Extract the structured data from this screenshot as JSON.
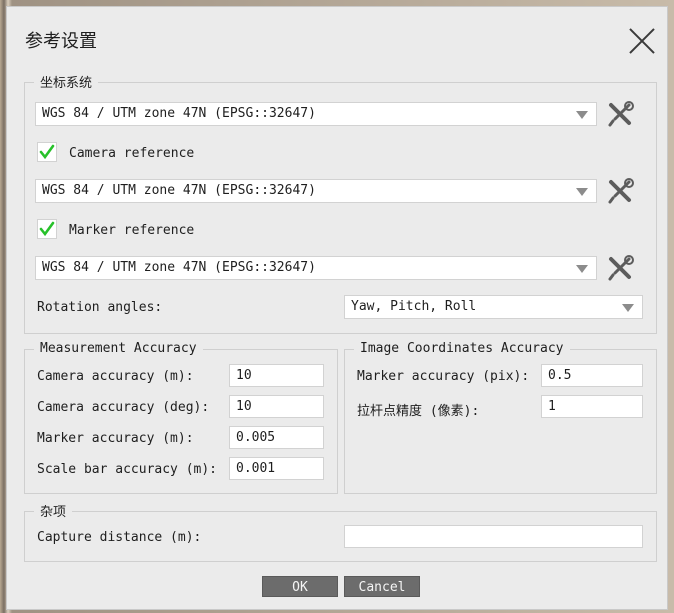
{
  "dialog": {
    "title": "参考设置"
  },
  "coordinate_system": {
    "legend": "坐标系统",
    "crs_primary": "WGS 84 / UTM zone 47N (EPSG::32647)",
    "camera_reference_label": "Camera reference",
    "camera_reference_checked": true,
    "camera_crs": "WGS 84 / UTM zone 47N (EPSG::32647)",
    "marker_reference_label": "Marker reference",
    "marker_reference_checked": true,
    "marker_crs": "WGS 84 / UTM zone 47N (EPSG::32647)",
    "rotation_angles_label": "Rotation angles:",
    "rotation_angles_value": "Yaw, Pitch, Roll"
  },
  "measurement_accuracy": {
    "legend": "Measurement Accuracy",
    "camera_accuracy_m_label": "Camera accuracy (m):",
    "camera_accuracy_m_value": "10",
    "camera_accuracy_deg_label": "Camera accuracy (deg):",
    "camera_accuracy_deg_value": "10",
    "marker_accuracy_m_label": "Marker accuracy (m):",
    "marker_accuracy_m_value": "0.005",
    "scale_bar_accuracy_label": "Scale bar accuracy (m):",
    "scale_bar_accuracy_value": "0.001"
  },
  "image_accuracy": {
    "legend": "Image Coordinates Accuracy",
    "marker_accuracy_pix_label": "Marker accuracy (pix):",
    "marker_accuracy_pix_value": "0.5",
    "tie_point_accuracy_label": "拉杆点精度 (像素):",
    "tie_point_accuracy_value": "1"
  },
  "misc": {
    "legend": "杂项",
    "capture_distance_label": "Capture distance (m):",
    "capture_distance_value": ""
  },
  "buttons": {
    "ok": "OK",
    "cancel": "Cancel"
  },
  "icons": {
    "close": "close-icon",
    "tools": "tools-icon",
    "check": "check-icon",
    "dropdown": "chevron-down-icon"
  },
  "colors": {
    "check": "#27c12a",
    "button_bg": "#6c6c6c",
    "dialog_bg": "#ebebeb"
  }
}
